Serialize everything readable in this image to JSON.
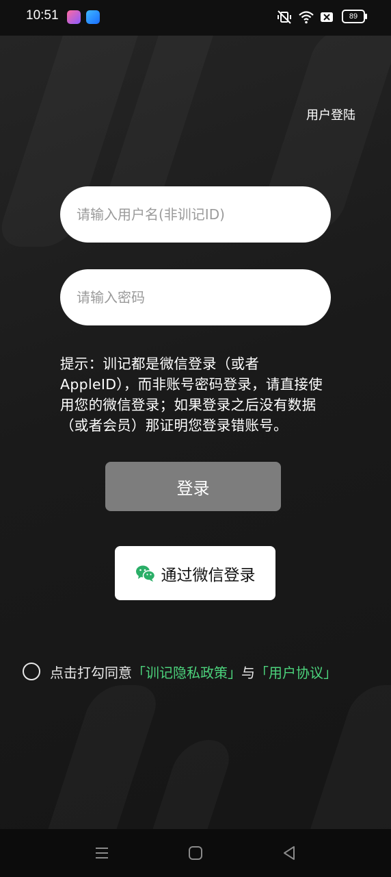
{
  "status_bar": {
    "time": "10:51",
    "battery": "89",
    "icons": [
      "app-icon-pink",
      "app-icon-blue",
      "vibrate-off-icon",
      "wifi-icon",
      "sim-off-icon",
      "battery-icon"
    ]
  },
  "header": {
    "link_label": "用户登陆"
  },
  "form": {
    "username_placeholder": "请输入用户名(非训记ID)",
    "password_placeholder": "请输入密码"
  },
  "hint_text": "提示：训记都是微信登录（或者AppleID），而非账号密码登录，请直接使用您的微信登录；如果登录之后没有数据（或者会员）那证明您登录错账号。",
  "buttons": {
    "login_label": "登录",
    "wechat_label": "通过微信登录"
  },
  "agreement": {
    "prefix": "点击打勾同意",
    "privacy_link": "「训记隐私政策」",
    "joiner": "与",
    "terms_link": "「用户协议」",
    "checked": false
  },
  "colors": {
    "background": "#1b1b1b",
    "link_green": "#4cd37c",
    "login_button": "#7d7d7d",
    "wechat_green": "#2aae67"
  }
}
